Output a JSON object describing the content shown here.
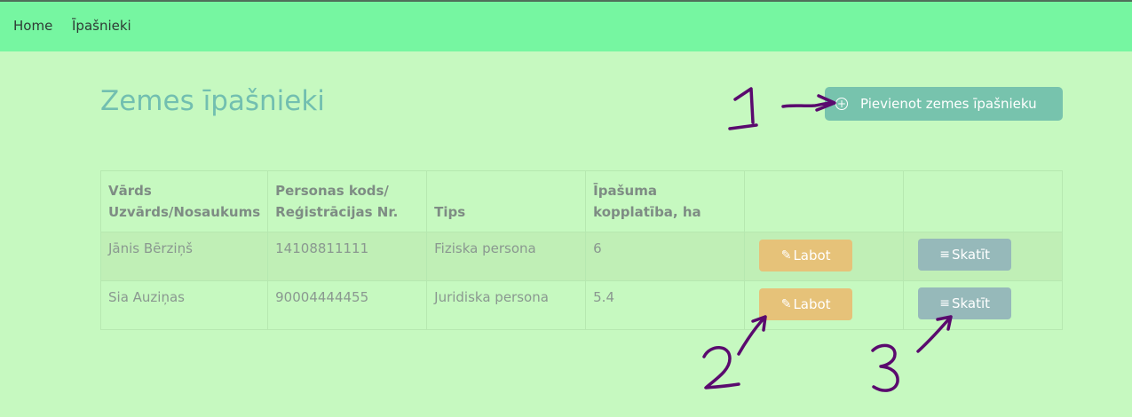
{
  "nav": {
    "items": [
      "Home",
      "Īpašnieki"
    ]
  },
  "page": {
    "title": "Zemes īpašnieki",
    "add_button_label": "Pievienot zemes īpašnieku"
  },
  "table": {
    "headers": {
      "name": "Vārds Uzvārds/Nosaukums",
      "code": "Personas kods/ Reģistrācijas Nr.",
      "type": "Tips",
      "area": "Īpašuma kopplatība, ha"
    },
    "rows": [
      {
        "name": "Jānis Bērziņš",
        "code": "14108811111",
        "type": "Fiziska persona",
        "area": "6"
      },
      {
        "name": "Sia Auziņas",
        "code": "90004444455",
        "type": "Juridiska persona",
        "area": "5.4"
      }
    ],
    "edit_label": "Labot",
    "view_label": "Skatīt"
  },
  "annotations": [
    "1",
    "2",
    "3"
  ],
  "colors": {
    "background": "#c6f9c0",
    "navbar": "#76f6a1",
    "title": "#72bfb0",
    "add_button": "#77c3ad",
    "edit_button": "#e6c279",
    "view_button": "#96b9ba",
    "annotation_ink": "#5a0a6e"
  },
  "icons": {
    "add": "circle-plus-icon",
    "edit": "pencil-square-icon",
    "view": "list-icon"
  }
}
